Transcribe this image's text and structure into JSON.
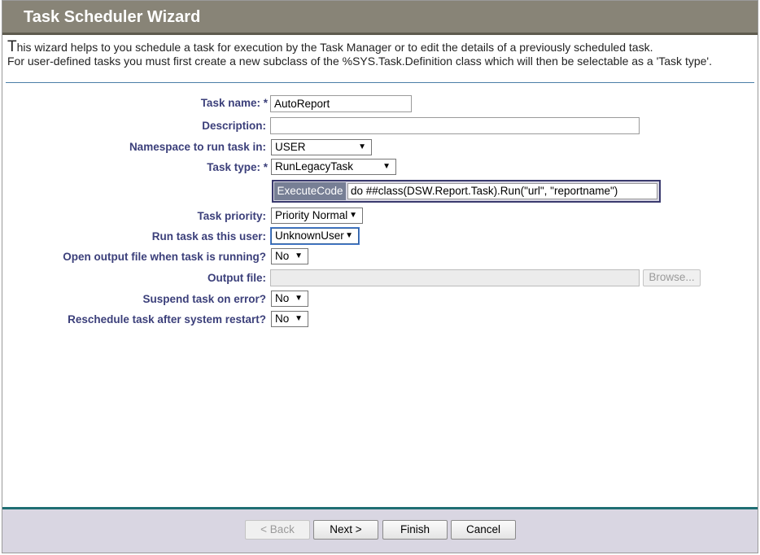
{
  "window": {
    "title": "Task Scheduler Wizard"
  },
  "intro": {
    "line1_first": "T",
    "line1_rest": "his wizard helps to you schedule a task for execution by the Task Manager or to edit the details of a previously scheduled task.",
    "line2": "For user-defined tasks you must first create a new subclass of the %SYS.Task.Definition class which will then be selectable as a 'Task type'."
  },
  "form": {
    "task_name": {
      "label": "Task name:",
      "required": "*",
      "value": "AutoReport"
    },
    "description": {
      "label": "Description:",
      "value": ""
    },
    "namespace": {
      "label": "Namespace to run task in:",
      "value": "USER"
    },
    "task_type": {
      "label": "Task type:",
      "required": "*",
      "value": "RunLegacyTask"
    },
    "execute_code": {
      "label": "ExecuteCode",
      "value": "do ##class(DSW.Report.Task).Run(\"url\", \"reportname\")"
    },
    "task_priority": {
      "label": "Task priority:",
      "value": "Priority Normal"
    },
    "run_as_user": {
      "label": "Run task as this user:",
      "value": "UnknownUser"
    },
    "open_output": {
      "label": "Open output file when task is running?",
      "value": "No"
    },
    "output_file": {
      "label": "Output file:",
      "value": "",
      "browse_label": "Browse..."
    },
    "suspend_on_error": {
      "label": "Suspend task on error?",
      "value": "No"
    },
    "reschedule": {
      "label": "Reschedule task after system restart?",
      "value": "No"
    }
  },
  "buttons": {
    "back": "< Back",
    "next": "Next >",
    "finish": "Finish",
    "cancel": "Cancel"
  },
  "icons": {
    "dropdown": "▼"
  },
  "colors": {
    "titlebar": "#888477",
    "label": "#3b3f7a",
    "footer": "#d9d6e2",
    "footer_border": "#1f6e73"
  }
}
